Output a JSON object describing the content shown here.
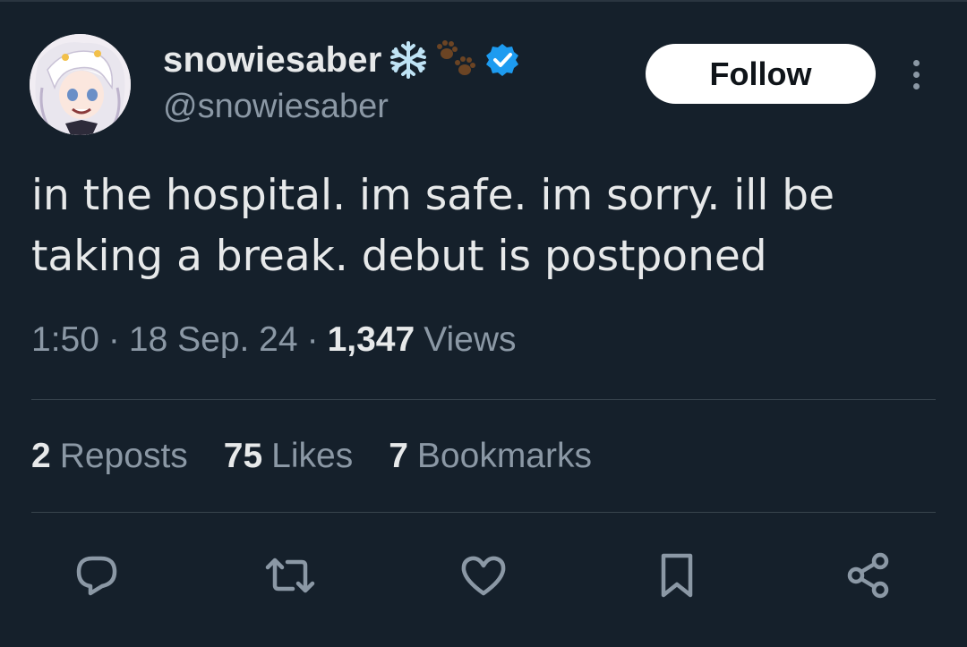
{
  "author": {
    "display_name": "snowiesaber",
    "handle": "@snowiesaber",
    "verified": true,
    "name_emojis": [
      "snowflake-emoji",
      "paw-prints-emoji"
    ]
  },
  "follow_label": "Follow",
  "tweet": {
    "text_lines": [
      "in the hospital. im safe. im sorry. ill be",
      "taking a break. debut is postponed"
    ]
  },
  "meta": {
    "time": "1:50",
    "separator": "·",
    "date": "18 Sep. 24",
    "views_count": "1,347",
    "views_label": "Views"
  },
  "stats": {
    "reposts_count": "2",
    "reposts_label": "Reposts",
    "likes_count": "75",
    "likes_label": "Likes",
    "bookmarks_count": "7",
    "bookmarks_label": "Bookmarks"
  },
  "actions": [
    "reply",
    "repost",
    "like",
    "bookmark",
    "share"
  ],
  "colors": {
    "background": "#15202b",
    "text": "#e7e9ea",
    "secondary_text": "#8b98a5",
    "divider": "#38444d",
    "verified_badge": "#1d9bf0"
  }
}
